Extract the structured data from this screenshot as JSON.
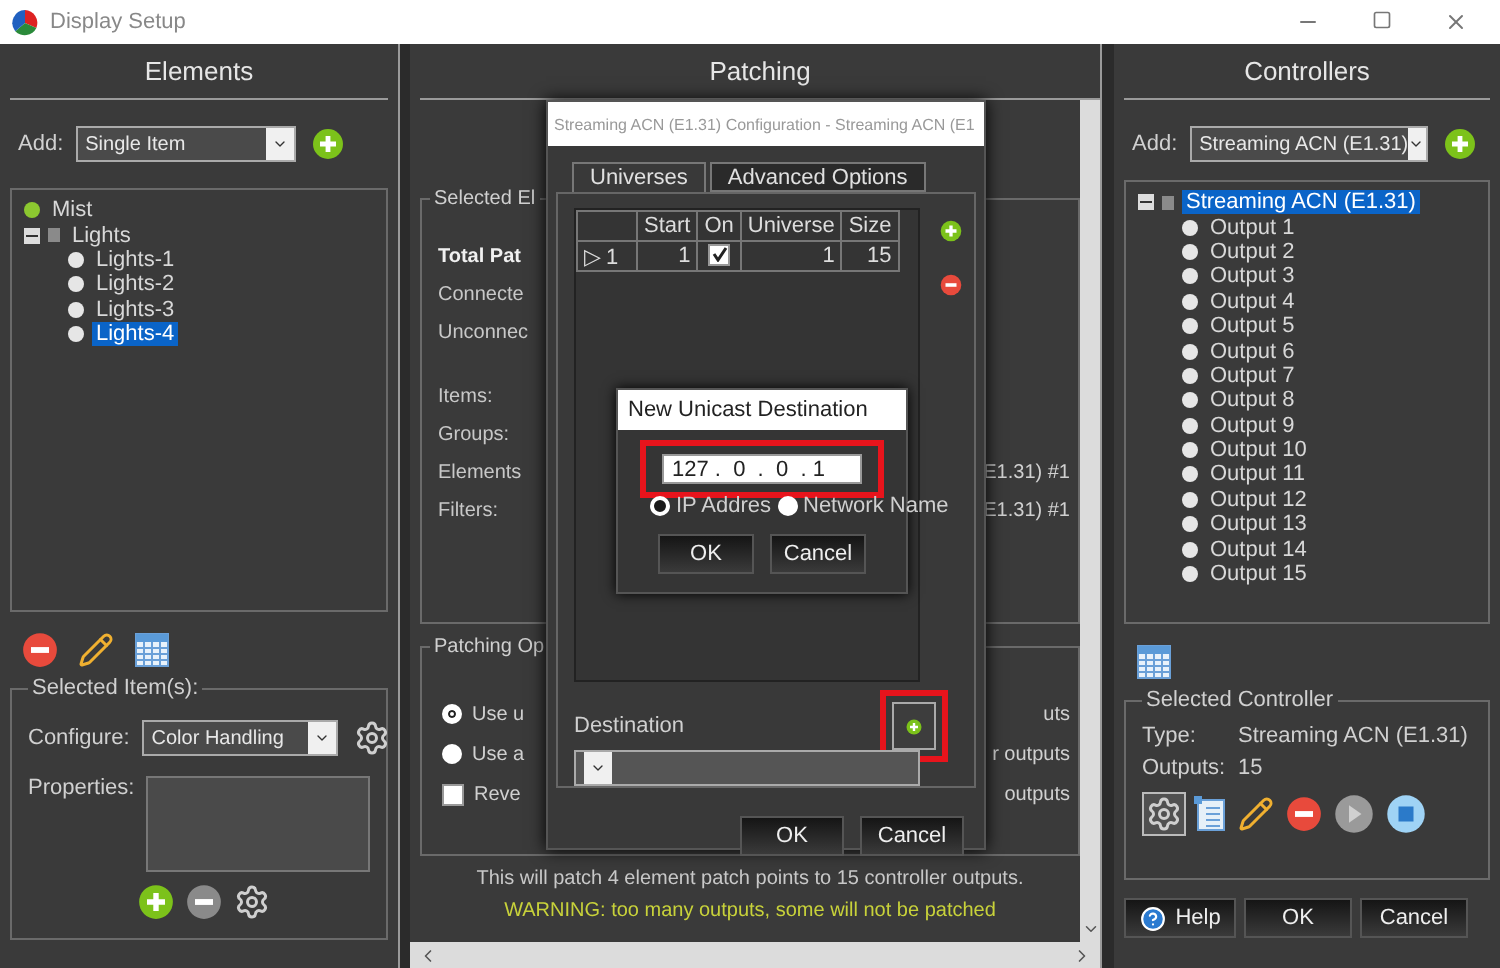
{
  "window": {
    "title": "Display Setup"
  },
  "elements": {
    "heading": "Elements",
    "add_label": "Add:",
    "add_value": "Single Item",
    "tree": [
      {
        "label": "Mist",
        "kind": "model",
        "selected": false
      },
      {
        "label": "Lights",
        "kind": "group",
        "expanded": true,
        "selected": false,
        "children": [
          {
            "label": "Lights-1",
            "kind": "node",
            "selected": false
          },
          {
            "label": "Lights-2",
            "kind": "node",
            "selected": false
          },
          {
            "label": "Lights-3",
            "kind": "node",
            "selected": false
          },
          {
            "label": "Lights-4",
            "kind": "node",
            "selected": true
          }
        ]
      }
    ],
    "tools": [
      {
        "kind": "delete",
        "disabled": false
      },
      {
        "kind": "edit",
        "disabled": false
      },
      {
        "kind": "grid",
        "disabled": false
      }
    ],
    "selected_items": {
      "title": "Selected Item(s):",
      "configure_label": "Configure:",
      "configure_value": "Color Handling",
      "properties_label": "Properties:",
      "tools": [
        {
          "kind": "add",
          "disabled": false
        },
        {
          "kind": "delete",
          "disabled": true
        },
        {
          "kind": "gear",
          "disabled": false
        }
      ]
    }
  },
  "patching": {
    "heading": "Patching",
    "selected_group": "Selected El",
    "rows": [
      {
        "label": "Total Pat",
        "strong": true
      },
      {
        "label": "Connecte",
        "strong": false
      },
      {
        "label": "Unconnec",
        "strong": false
      },
      {
        "label": "Items:",
        "strong": false
      },
      {
        "label": "Groups:",
        "strong": false
      },
      {
        "label": "Elements",
        "strong": false,
        "value": "E1.31) #1"
      },
      {
        "label": "Filters:",
        "strong": false,
        "value": "E1.31) #1"
      }
    ],
    "options_group": "Patching Op",
    "options": [
      {
        "kind": "radio",
        "label": "Use u",
        "selected": true,
        "note": "uts"
      },
      {
        "kind": "radio",
        "label": "Use a",
        "selected": false,
        "note": "r outputs"
      },
      {
        "kind": "checkbox",
        "label": "Reve",
        "checked": false,
        "note": "outputs"
      }
    ],
    "summary": "This will patch 4 element patch points to 15 controller outputs.",
    "warning": "WARNING: too many outputs, some will not be patched"
  },
  "config_dialog": {
    "title": "Streaming ACN (E1.31) Configuration - Streaming ACN (E1",
    "tabs": [
      {
        "label": "Universes",
        "selected": true
      },
      {
        "label": "Advanced Options",
        "selected": false
      }
    ],
    "columns": [
      "Start",
      "On",
      "Universe",
      "Size"
    ],
    "rows": [
      {
        "marker": "▷ 1",
        "start": "1",
        "on": true,
        "universe": "1",
        "size": "15"
      }
    ],
    "destination_label": "Destination",
    "add_highlighted": true,
    "buttons": [
      "OK",
      "Cancel"
    ]
  },
  "unicast_dialog": {
    "title": "New Unicast Destination",
    "ip_address": "127 .  0  .  0  . 1",
    "highlighted": true,
    "radios": [
      {
        "label": "IP Addres",
        "selected": true
      },
      {
        "label": "Network Name",
        "selected": false
      }
    ],
    "buttons": [
      "OK",
      "Cancel"
    ]
  },
  "controllers": {
    "heading": "Controllers",
    "add_label": "Add:",
    "add_value": "Streaming ACN (E1.31)",
    "tree": [
      {
        "label": "Streaming ACN (E1.31)",
        "kind": "group",
        "expanded": true,
        "selected": true,
        "children": [
          {
            "label": "Output 1",
            "kind": "node",
            "selected": false
          },
          {
            "label": "Output 2",
            "kind": "node",
            "selected": false
          },
          {
            "label": "Output 3",
            "kind": "node",
            "selected": false
          },
          {
            "label": "Output 4",
            "kind": "node",
            "selected": false
          },
          {
            "label": "Output 5",
            "kind": "node",
            "selected": false
          },
          {
            "label": "Output 6",
            "kind": "node",
            "selected": false
          },
          {
            "label": "Output 7",
            "kind": "node",
            "selected": false
          },
          {
            "label": "Output 8",
            "kind": "node",
            "selected": false
          },
          {
            "label": "Output 9",
            "kind": "node",
            "selected": false
          },
          {
            "label": "Output 10",
            "kind": "node",
            "selected": false
          },
          {
            "label": "Output 11",
            "kind": "node",
            "selected": false
          },
          {
            "label": "Output 12",
            "kind": "node",
            "selected": false
          },
          {
            "label": "Output 13",
            "kind": "node",
            "selected": false
          },
          {
            "label": "Output 14",
            "kind": "node",
            "selected": false
          },
          {
            "label": "Output 15",
            "kind": "node",
            "selected": false
          }
        ]
      }
    ],
    "selected_controller": {
      "title": "Selected Controller",
      "fields": [
        {
          "label": "Type:",
          "value": "Streaming ACN (E1.31)"
        },
        {
          "label": "Outputs:",
          "value": "15"
        }
      ],
      "tools": [
        {
          "kind": "gear",
          "disabled": false
        },
        {
          "kind": "list",
          "disabled": false
        },
        {
          "kind": "edit",
          "disabled": false
        },
        {
          "kind": "delete",
          "disabled": false
        },
        {
          "kind": "play",
          "disabled": true
        },
        {
          "kind": "stop",
          "disabled": false
        }
      ]
    },
    "footer": [
      {
        "kind": "help",
        "label": "Help"
      },
      {
        "kind": "plain",
        "label": "OK"
      },
      {
        "kind": "plain",
        "label": "Cancel"
      }
    ]
  }
}
